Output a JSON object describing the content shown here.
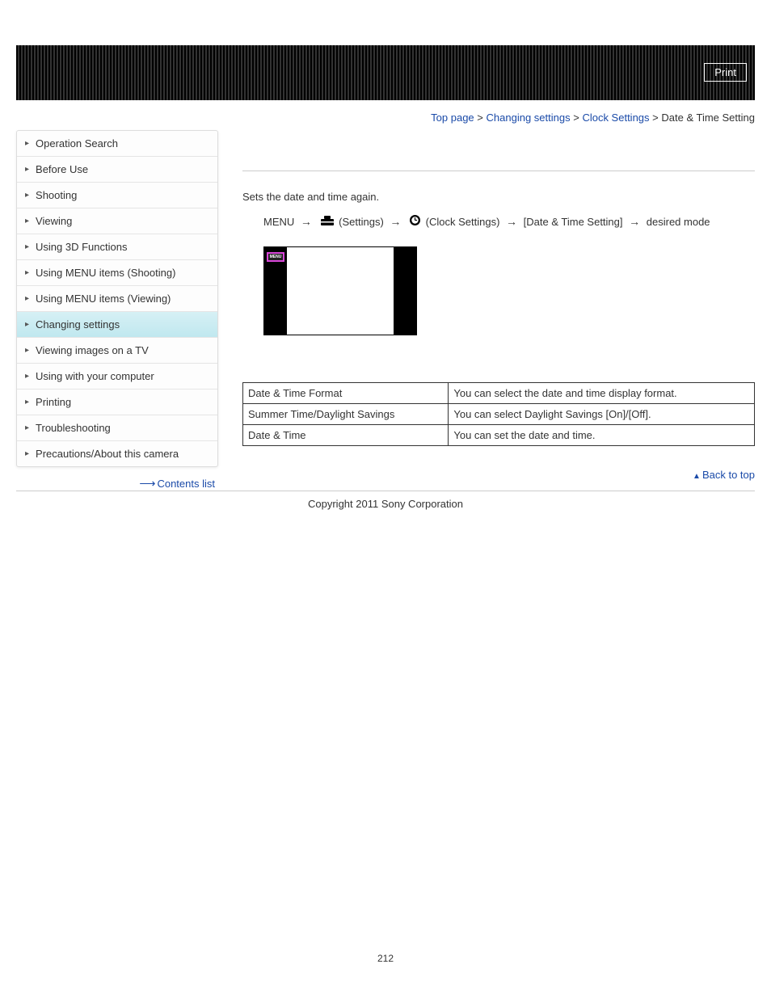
{
  "header": {
    "print": "Print"
  },
  "breadcrumb": {
    "top_page": "Top page",
    "changing_settings": "Changing settings",
    "clock_settings": "Clock Settings",
    "current": "Date & Time Setting",
    "sep": ">"
  },
  "sidebar": {
    "items": [
      "Operation Search",
      "Before Use",
      "Shooting",
      "Viewing",
      "Using 3D Functions",
      "Using MENU items (Shooting)",
      "Using MENU items (Viewing)",
      "Changing settings",
      "Viewing images on a TV",
      "Using with your computer",
      "Printing",
      "Troubleshooting",
      "Precautions/About this camera"
    ],
    "contents_list": "Contents list"
  },
  "main": {
    "intro": "Sets the date and time again.",
    "path": {
      "menu": "MENU",
      "settings": "(Settings)",
      "clock": "(Clock Settings)",
      "setting": "[Date & Time Setting]",
      "desired": "desired mode"
    },
    "thumb_menu": "MENU",
    "table": {
      "rows": [
        {
          "name": "Date & Time Format",
          "desc": "You can select the date and time display format."
        },
        {
          "name": "Summer Time/Daylight Savings",
          "desc": "You can select Daylight Savings [On]/[Off]."
        },
        {
          "name": "Date & Time",
          "desc": "You can set the date and time."
        }
      ]
    }
  },
  "back_to_top": "Back to top",
  "copyright": "Copyright 2011 Sony Corporation",
  "page_number": "212"
}
